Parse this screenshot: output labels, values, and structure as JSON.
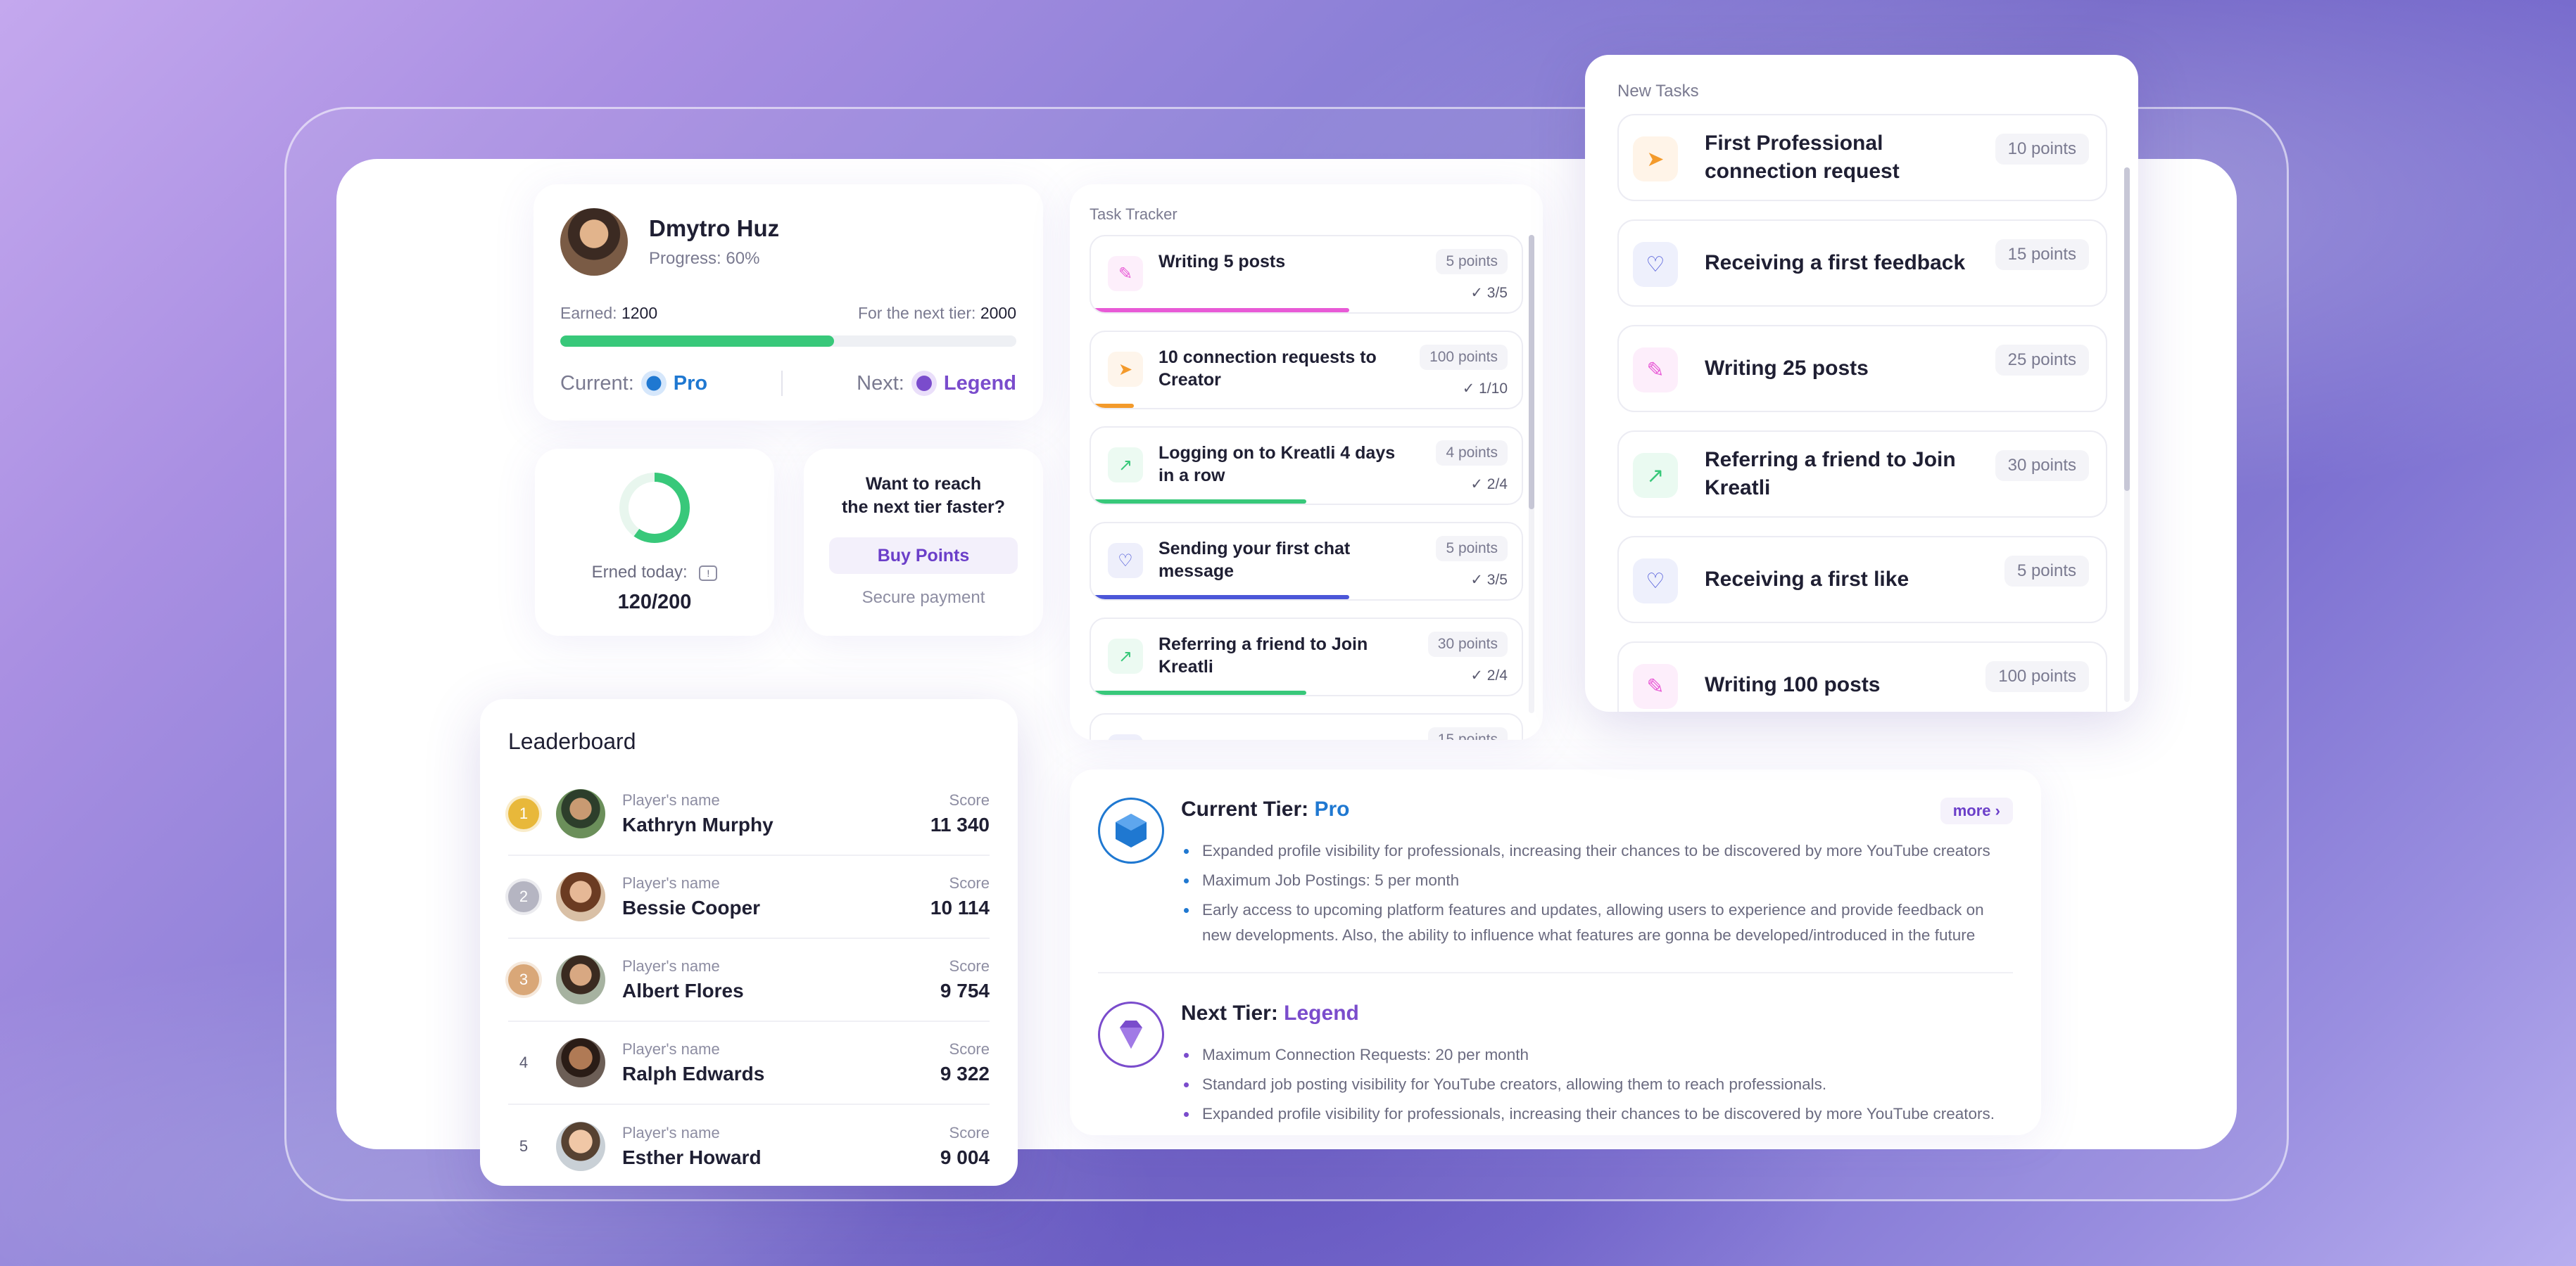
{
  "colors": {
    "accent_purple": "#7a4ccc",
    "pro_blue": "#1f78d1",
    "progress_green": "#38c87a"
  },
  "profile": {
    "name": "Dmytro Huz",
    "progress": "Progress: 60%",
    "progress_fraction": 0.6,
    "earned_label": "Earned:",
    "earned_value": "1200",
    "next_label": "For the next tier:",
    "next_value": "2000",
    "current_label": "Current:",
    "current_tier": "Pro",
    "next_tier_label": "Next:",
    "next_tier": "Legend"
  },
  "daily": {
    "label": "Erned today:",
    "value": "120/200",
    "fraction": 0.6
  },
  "buy": {
    "line1": "Want to reach",
    "line2": "the next tier faster?",
    "button": "Buy Points",
    "secure": "Secure payment"
  },
  "tracker": {
    "title": "Task Tracker",
    "items": [
      {
        "name": "Writing 5 posts",
        "points": "5 points",
        "count": "3/5",
        "fraction": 0.6,
        "icon": "edit-icon",
        "color": "#e85ad6"
      },
      {
        "name": "10 connection requests to Creator",
        "points": "100 points",
        "count": "1/10",
        "fraction": 0.1,
        "icon": "send-icon",
        "color": "#f39a2b"
      },
      {
        "name": "Logging on to Kreatli 4 days in a row",
        "points": "4 points",
        "count": "2/4",
        "fraction": 0.5,
        "icon": "chart-icon",
        "color": "#38c87a"
      },
      {
        "name": "Sending your first chat message",
        "points": "5 points",
        "count": "3/5",
        "fraction": 0.6,
        "icon": "chat-icon",
        "color": "#4b56d8"
      },
      {
        "name": "Referring a friend to Join Kreatli",
        "points": "30 points",
        "count": "2/4",
        "fraction": 0.5,
        "icon": "chart-icon",
        "color": "#38c87a"
      },
      {
        "name": "",
        "points": "15 points",
        "count": "",
        "fraction": 0,
        "icon": "chat-icon",
        "color": "#4b56d8"
      }
    ]
  },
  "new_tasks": {
    "title": "New Tasks",
    "items": [
      {
        "name": "First Professional connection request",
        "points": "10 points",
        "icon": "send-icon",
        "color": "#f39a2b",
        "bg": "#fff4e8"
      },
      {
        "name": "Receiving a first feedback",
        "points": "15 points",
        "icon": "chat-heart-icon",
        "color": "#4b56d8",
        "bg": "#eef0fc"
      },
      {
        "name": "Writing 25 posts",
        "points": "25 points",
        "icon": "edit-icon",
        "color": "#e85ad6",
        "bg": "#fdeefb"
      },
      {
        "name": "Referring a friend to Join Kreatli",
        "points": "30 points",
        "icon": "chart-icon",
        "color": "#38c87a",
        "bg": "#eafaf1"
      },
      {
        "name": "Receiving a first like",
        "points": "5 points",
        "icon": "chat-heart-icon",
        "color": "#4b56d8",
        "bg": "#eef0fc"
      },
      {
        "name": "Writing 100 posts",
        "points": "100 points",
        "icon": "edit-icon",
        "color": "#e85ad6",
        "bg": "#fdeefb"
      }
    ]
  },
  "leaderboard": {
    "title": "Leaderboard",
    "caption_name": "Player's name",
    "caption_score": "Score",
    "rows": [
      {
        "rank": "1",
        "name": "Kathryn Murphy",
        "score": "11 340",
        "medal": "#e8b83a"
      },
      {
        "rank": "2",
        "name": "Bessie Cooper",
        "score": "10 114",
        "medal": "#b5b5c2"
      },
      {
        "rank": "3",
        "name": "Albert Flores",
        "score": "9 754",
        "medal": "#d9a778"
      },
      {
        "rank": "4",
        "name": "Ralph Edwards",
        "score": "9 322",
        "medal": ""
      },
      {
        "rank": "5",
        "name": "Esther Howard",
        "score": "9 004",
        "medal": ""
      }
    ]
  },
  "tier_info": {
    "current_label": "Current Tier:",
    "current_name": "Pro",
    "more": "more",
    "current_benefits": [
      "Expanded profile visibility for professionals, increasing their chances to be discovered by more YouTube creators",
      "Maximum Job Postings: 5 per month",
      "Early access to upcoming platform features and updates, allowing users to experience and provide feedback on new developments. Also, the ability to influence what features are gonna be developed/introduced in the future"
    ],
    "next_label": "Next Tier:",
    "next_name": "Legend",
    "next_benefits": [
      "Maximum Connection Requests: 20 per month",
      "Standard job posting visibility for YouTube creators, allowing them to reach professionals.",
      "Expanded profile visibility for professionals, increasing their chances to be discovered by more YouTube creators."
    ]
  }
}
